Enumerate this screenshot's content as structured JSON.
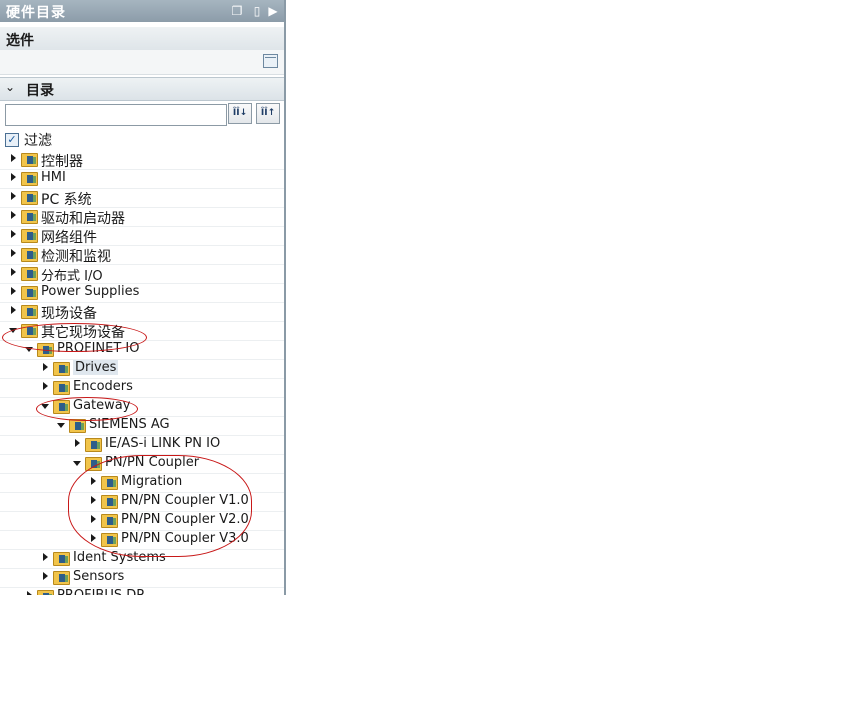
{
  "panel": {
    "title": "硬件目录",
    "options_header": "选件",
    "catalog_header": "目录",
    "search": {
      "value": "",
      "placeholder": ""
    },
    "filter_label": "过滤",
    "filter_checked": true
  },
  "tree": [
    {
      "label": "控制器",
      "level": 0,
      "state": "collapsed",
      "big": true
    },
    {
      "label": "HMI",
      "level": 0,
      "state": "collapsed"
    },
    {
      "label": "PC 系统",
      "level": 0,
      "state": "collapsed",
      "big": true
    },
    {
      "label": "驱动和启动器",
      "level": 0,
      "state": "collapsed",
      "big": true
    },
    {
      "label": "网络组件",
      "level": 0,
      "state": "collapsed",
      "big": true
    },
    {
      "label": "检测和监视",
      "level": 0,
      "state": "collapsed",
      "big": true
    },
    {
      "label": "分布式 I/O",
      "level": 0,
      "state": "collapsed"
    },
    {
      "label": "Power Supplies",
      "level": 0,
      "state": "collapsed"
    },
    {
      "label": "现场设备",
      "level": 0,
      "state": "collapsed",
      "big": true
    },
    {
      "label": "其它现场设备",
      "level": 0,
      "state": "expanded",
      "big": true
    },
    {
      "label": "PROFINET IO",
      "level": 1,
      "state": "expanded"
    },
    {
      "label": "Drives",
      "level": 2,
      "state": "collapsed",
      "selected": true
    },
    {
      "label": "Encoders",
      "level": 2,
      "state": "collapsed"
    },
    {
      "label": "Gateway",
      "level": 2,
      "state": "expanded"
    },
    {
      "label": "SIEMENS AG",
      "level": 3,
      "state": "expanded"
    },
    {
      "label": "IE/AS-i LINK PN IO",
      "level": 4,
      "state": "collapsed"
    },
    {
      "label": "PN/PN Coupler",
      "level": 4,
      "state": "expanded"
    },
    {
      "label": "Migration",
      "level": 5,
      "state": "collapsed"
    },
    {
      "label": "PN/PN Coupler V1.0",
      "level": 5,
      "state": "collapsed"
    },
    {
      "label": "PN/PN Coupler V2.0",
      "level": 5,
      "state": "collapsed"
    },
    {
      "label": "PN/PN Coupler V3.0",
      "level": 5,
      "state": "collapsed"
    },
    {
      "label": "Ident Systems",
      "level": 2,
      "state": "collapsed"
    },
    {
      "label": "Sensors",
      "level": 2,
      "state": "collapsed"
    },
    {
      "label": "PROFIBUS DP",
      "level": 1,
      "state": "collapsed"
    }
  ],
  "colors": {
    "annotation": "#c81818",
    "titlebar": "#96a6b2"
  }
}
